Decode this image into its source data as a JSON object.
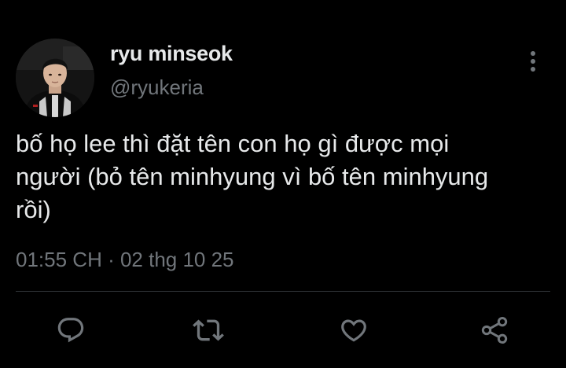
{
  "tweet": {
    "author": {
      "display_name": "ryu minseok",
      "handle": "@ryukeria"
    },
    "text": "bố họ lee thì đặt tên con họ gì được mọi\nngười (bỏ tên minhyung vì bố tên minhyung\nrồi)",
    "timestamp": "01:55 CH · 02 thg 10 25"
  },
  "icons": {
    "more": "more-vertical-icon",
    "reply": "reply-icon",
    "retweet": "retweet-icon",
    "like": "heart-icon",
    "share": "share-icon"
  },
  "colors": {
    "background": "#000000",
    "primary_text": "#e7e9ea",
    "secondary_text": "#71767b",
    "divider": "#2f3336"
  }
}
